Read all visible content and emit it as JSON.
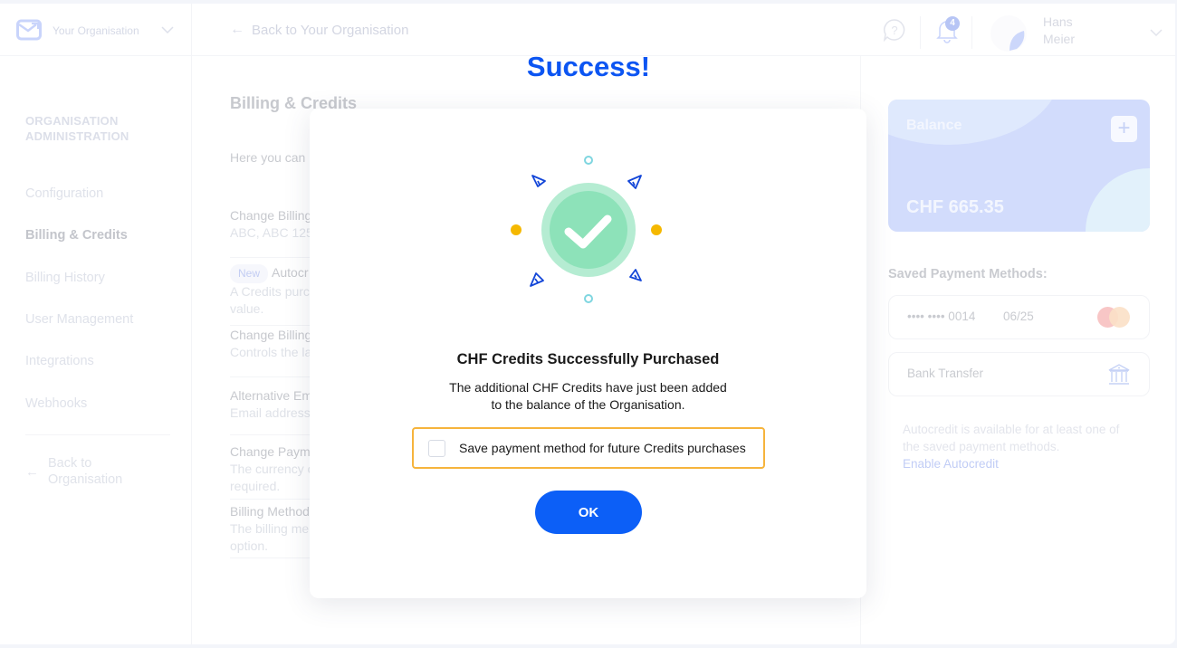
{
  "topbar": {
    "org_name": "Your Organisation",
    "back_link": "Back to Your Organisation",
    "notification_count": "4",
    "user_first_name": "Hans",
    "user_last_name": "Meier"
  },
  "sidebar": {
    "heading_line1": "ORGANISATION",
    "heading_line2": "ADMINISTRATION",
    "items": [
      {
        "label": "Configuration",
        "active": false
      },
      {
        "label": "Billing & Credits",
        "active": true
      },
      {
        "label": "Billing History",
        "active": false
      },
      {
        "label": "User Management",
        "active": false
      },
      {
        "label": "Integrations",
        "active": false
      },
      {
        "label": "Webhooks",
        "active": false
      }
    ],
    "back_line1": "Back to",
    "back_line2": "Organisation"
  },
  "main": {
    "title": "Billing & Credits",
    "intro": "Here you can m",
    "settings": [
      {
        "title": "Change Billing",
        "desc": "ABC, ABC 125"
      },
      {
        "badge": "New",
        "title": "Autocr",
        "desc_line1": "A Credits purc",
        "desc_line2": "value."
      },
      {
        "title": "Change Billing",
        "desc": "Controls the la"
      },
      {
        "title": "Alternative Em",
        "desc": "Email address"
      },
      {
        "title": "Change Paym",
        "desc_line1": "The currency o",
        "desc_line2": "required."
      },
      {
        "title": "Billing Method",
        "desc_line1": "The billing me",
        "desc_line2": "option."
      }
    ]
  },
  "right_panel": {
    "balance_label": "Balance",
    "balance_amount": "CHF 665.35",
    "add_symbol": "+",
    "saved_title": "Saved Payment Methods:",
    "card_number": "•••• •••• 0014",
    "card_expiry": "06/25",
    "bank_transfer": "Bank Transfer",
    "autocredit_text": "Autocredit is available for at least one of the saved payment methods.",
    "autocredit_link": "Enable Autocredit"
  },
  "modal": {
    "heading": "Success!",
    "title": "CHF Credits Successfully Purchased",
    "desc_line1": "The additional CHF Credits have just been added",
    "desc_line2": "to the balance of the Organisation.",
    "checkbox_label": "Save payment method for future Credits purchases",
    "checkbox_checked": false,
    "ok_label": "OK"
  },
  "colors": {
    "primary": "#0c5ff7",
    "heading_blue": "#0c55f2",
    "success_green": "#8de2b9",
    "highlight_orange": "#f6b43c",
    "dot_yellow": "#f5b800",
    "ring_cyan": "#7fd6e0"
  }
}
